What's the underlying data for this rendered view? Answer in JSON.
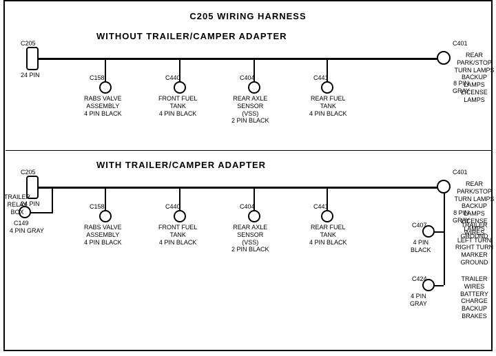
{
  "title": "C205 WIRING HARNESS",
  "section1": {
    "label": "WITHOUT  TRAILER/CAMPER ADAPTER",
    "connectors": {
      "c205": {
        "id": "C205",
        "pins": "24 PIN"
      },
      "c401": {
        "id": "C401",
        "pins": "8 PIN",
        "color": "GRAY"
      },
      "c158": {
        "id": "C158",
        "desc": "RABS VALVE\nASSEMBLY\n4 PIN BLACK"
      },
      "c440": {
        "id": "C440",
        "desc": "FRONT FUEL\nTANK\n4 PIN BLACK"
      },
      "c404": {
        "id": "C404",
        "desc": "REAR AXLE\nSENSOR\n(VSS)\n2 PIN BLACK"
      },
      "c441": {
        "id": "C441",
        "desc": "REAR FUEL\nTANK\n4 PIN BLACK"
      }
    },
    "c401_label": "REAR PARK/STOP\nTURN LAMPS\nBACKUP LAMPS\nLICENSE LAMPS"
  },
  "section2": {
    "label": "WITH  TRAILER/CAMPER ADAPTER",
    "connectors": {
      "c205": {
        "id": "C205",
        "pins": "24 PIN"
      },
      "c401": {
        "id": "C401",
        "pins": "8 PIN",
        "color": "GRAY"
      },
      "c158": {
        "id": "C158",
        "desc": "RABS VALVE\nASSEMBLY\n4 PIN BLACK"
      },
      "c440": {
        "id": "C440",
        "desc": "FRONT FUEL\nTANK\n4 PIN BLACK"
      },
      "c404": {
        "id": "C404",
        "desc": "REAR AXLE\nSENSOR\n(VSS)\n2 PIN BLACK"
      },
      "c441": {
        "id": "C441",
        "desc": "REAR FUEL\nTANK\n4 PIN BLACK"
      },
      "c149": {
        "id": "C149",
        "pins": "4 PIN GRAY",
        "desc": "TRAILER\nRELAY\nBOX"
      },
      "c407": {
        "id": "C407",
        "pins": "4 PIN\nBLACK",
        "desc": "TRAILER WIRES\nLEFT TURN\nRIGHT TURN\nMARKER\nGROUND"
      },
      "c424": {
        "id": "C424",
        "pins": "4 PIN\nGRAY",
        "desc": "TRAILER WIRES\nBATTERY CHARGE\nBACKUP\nBRAKES"
      }
    },
    "c401_label": "REAR PARK/STOP\nTURN LAMPS\nBACKUP LAMPS\nLICENSE LAMPS\nGROUND"
  }
}
